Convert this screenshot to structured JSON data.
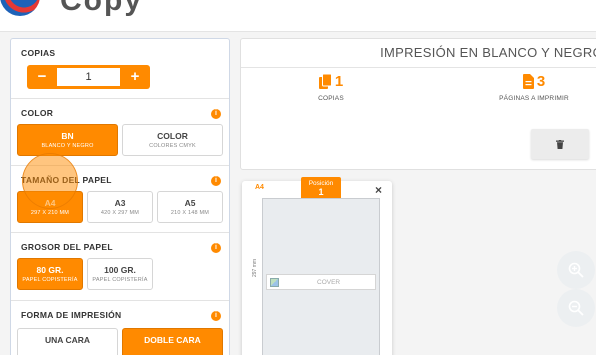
{
  "header": {
    "brand": "Copy"
  },
  "copies": {
    "title": "COPIAS",
    "minus": "−",
    "plus": "+",
    "value": "1"
  },
  "color": {
    "title": "COLOR",
    "options": [
      {
        "label": "BN",
        "sub": "BLANCO Y NEGRO",
        "selected": true
      },
      {
        "label": "COLOR",
        "sub": "COLORES CMYK",
        "selected": false
      }
    ]
  },
  "paper_size": {
    "title": "TAMAÑO DEL PAPEL",
    "options": [
      {
        "label": "A4",
        "sub": "297 X 210 MM",
        "selected": true
      },
      {
        "label": "A3",
        "sub": "420 X 297 MM",
        "selected": false
      },
      {
        "label": "A5",
        "sub": "210 X 148 MM",
        "selected": false
      }
    ]
  },
  "paper_weight": {
    "title": "GROSOR DEL PAPEL",
    "options": [
      {
        "label": "80 GR.",
        "sub": "PAPEL COPISTERÍA",
        "selected": true
      },
      {
        "label": "100 GR.",
        "sub": "PAPEL COPISTERÍA",
        "selected": false
      }
    ]
  },
  "print_form": {
    "title": "FORMA DE IMPRESIÓN",
    "options": [
      {
        "label": "UNA CARA",
        "selected": false
      },
      {
        "label": "DOBLE CARA",
        "selected": true
      }
    ]
  },
  "summary": {
    "title": "IMPRESIÓN EN BLANCO Y NEGRO",
    "copies_count": "1",
    "copies_label": "COPIAS",
    "pages_count": "3",
    "pages_label": "PÁGINAS A IMPRIMIR"
  },
  "page_preview": {
    "size_badge": "A4",
    "position_label": "Posición",
    "position_value": "1",
    "close": "×",
    "dimension": "297 mm",
    "image_alt": "COVER"
  },
  "icons": {
    "copies": "copy-icon",
    "pages": "file-icon",
    "trash": "trash-icon",
    "zoom_in": "zoom-in-icon",
    "zoom_out": "zoom-out-icon",
    "info": "info-icon"
  },
  "colors": {
    "accent": "#ff8a00",
    "panel_border": "#cfd8e6"
  }
}
